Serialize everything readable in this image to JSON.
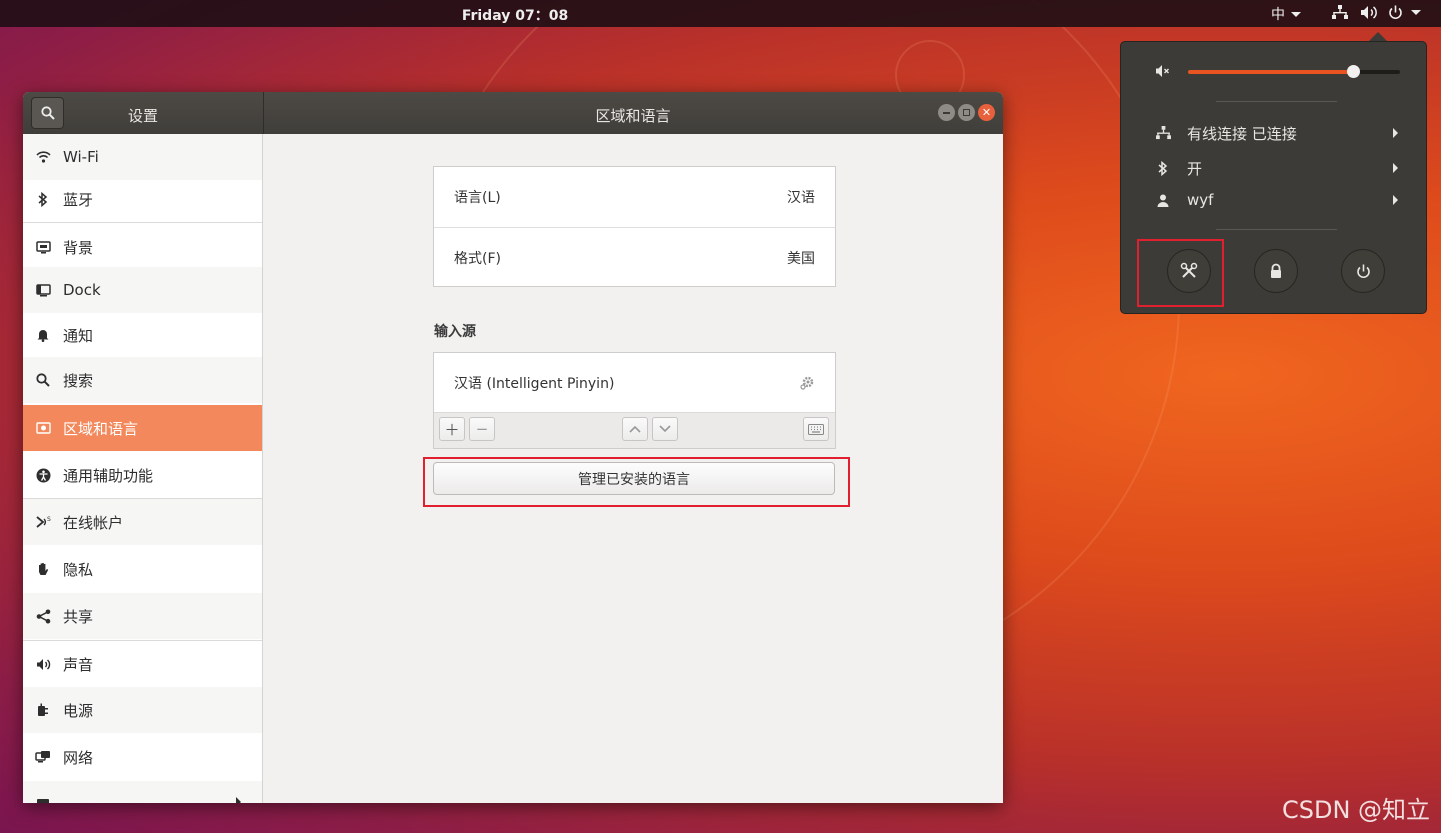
{
  "topbar": {
    "clock": "Friday 07：08",
    "input_method": "中",
    "colors": {
      "bar": "#1e0e14"
    }
  },
  "window": {
    "sidebar_title": "设置",
    "title": "区域和语言",
    "accent": "#f2885b"
  },
  "sidebar": {
    "items": [
      {
        "label": "Wi-Fi",
        "icon": "wifi-icon"
      },
      {
        "label": "蓝牙",
        "icon": "bluetooth-icon"
      },
      {
        "label": "背景",
        "icon": "background-icon"
      },
      {
        "label": "Dock",
        "icon": "dock-icon"
      },
      {
        "label": "通知",
        "icon": "bell-icon"
      },
      {
        "label": "搜索",
        "icon": "search-icon"
      },
      {
        "label": "区域和语言",
        "icon": "region-icon"
      },
      {
        "label": "通用辅助功能",
        "icon": "accessibility-icon"
      },
      {
        "label": "在线帐户",
        "icon": "online-accounts-icon"
      },
      {
        "label": "隐私",
        "icon": "hand-icon"
      },
      {
        "label": "共享",
        "icon": "share-icon"
      },
      {
        "label": "声音",
        "icon": "speaker-icon"
      },
      {
        "label": "电源",
        "icon": "power-plug-icon"
      },
      {
        "label": "网络",
        "icon": "network-icon"
      }
    ]
  },
  "main": {
    "language_label": "语言(L)",
    "language_value": "汉语",
    "format_label": "格式(F)",
    "format_value": "美国",
    "input_sources_title": "输入源",
    "input_source": "汉语 (Intelligent Pinyin)",
    "manage_button": "管理已安装的语言"
  },
  "system_menu": {
    "wired": "有线连接 已连接",
    "bluetooth": "开",
    "user": "wyf",
    "volume_percent": 78
  },
  "watermark": "CSDN @知立"
}
